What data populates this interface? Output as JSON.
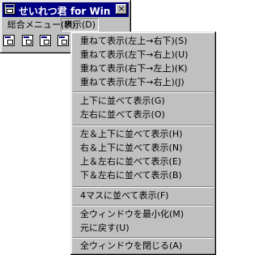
{
  "window": {
    "title": "せいれつ君 for Win",
    "close_glyph": "×"
  },
  "menubar": {
    "items": [
      "総合メニュー(M)",
      "表示(D)"
    ]
  },
  "dropdown": {
    "groups": [
      [
        "重ねて表示(左上→右下)(S)",
        "重ねて表示(左下→右上)(U)",
        "重ねて表示(右下→左上)(K)",
        "重ねて表示(左下→右上)(J)"
      ],
      [
        "上下に並べて表示(G)",
        "左右に並べて表示(O)"
      ],
      [
        "左＆上下に並べて表示(H)",
        "右＆上下に並べて表示(N)",
        "上＆左右に並べて表示(E)",
        "下＆左右に並べて表示(B)"
      ],
      [
        "4マスに並べて表示(F)"
      ],
      [
        "全ウィンドウを最小化(M)",
        "元に戻す(U)"
      ],
      [
        "全ウィンドウを閉じる(A)"
      ]
    ]
  }
}
